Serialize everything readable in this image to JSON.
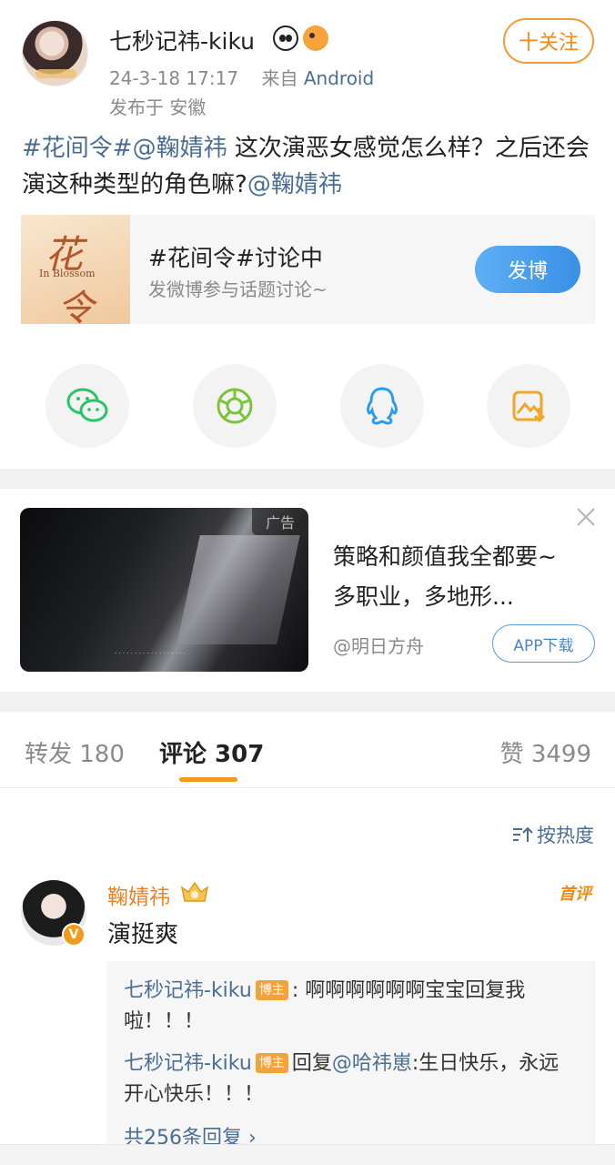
{
  "post": {
    "author": "七秒记祎-kiku",
    "time": "24-3-18 17:17",
    "source_prefix": "来自",
    "source": "Android",
    "location": "发布于 安徽",
    "follow_label": "十关注",
    "text_topic": "#花间令#",
    "text_mention": "@鞠婧祎",
    "text_body": " 这次演恶女感觉怎么样？之后还会演这种类型的角色嘛?",
    "text_mention2": "@鞠婧祎"
  },
  "topic_card": {
    "thumb_t1": "花",
    "thumb_t2": "In Blossom",
    "thumb_t3": "令",
    "title": "#花间令#讨论中",
    "subtitle": "发微博参与话题讨论~",
    "button_label": "发博"
  },
  "share": {
    "icons": [
      "wechat-icon",
      "moments-icon",
      "qq-icon",
      "save-image-icon"
    ]
  },
  "ad": {
    "tag": "广告",
    "title": "策略和颜值我全都要~多职业，多地形...",
    "source": "@明日方舟",
    "download_label": "APP下载"
  },
  "tabs": {
    "repost": "转发 180",
    "comment": "评论 307",
    "like": "赞 3499"
  },
  "sort_label": "按热度",
  "comment": {
    "author": "鞠婧祎",
    "first_badge": "首评",
    "verified_badge": "V",
    "text": "演挺爽",
    "replies": [
      {
        "author": "七秒记祎-kiku",
        "tag": "博主",
        "text": ": 啊啊啊啊啊啊宝宝回复我啦！！！"
      },
      {
        "author": "七秒记祎-kiku",
        "tag": "博主",
        "prefix": "回复",
        "mention": "@哈祎崽",
        "text": ":生日快乐，永远开心快乐！！！"
      }
    ],
    "more_replies": "共256条回复 ›"
  },
  "colors": {
    "accent_orange": "#f29a1c",
    "link_blue": "#4a6e93",
    "button_blue": "#3a8fe6"
  }
}
